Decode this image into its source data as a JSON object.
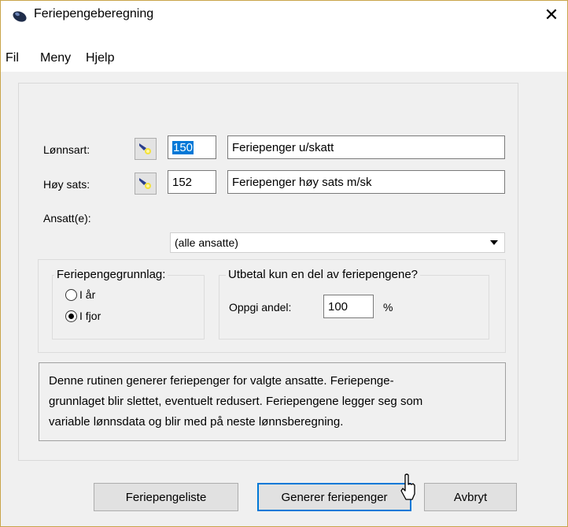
{
  "window": {
    "title": "Feriepengeberegning",
    "close_glyph": "✕"
  },
  "menu": [
    "Fil",
    "Meny",
    "Hjelp"
  ],
  "form": {
    "lonnsart": {
      "label": "Lønnsart:",
      "code": "150",
      "description": "Feriepenger u/skatt"
    },
    "hoy_sats": {
      "label": "Høy sats:",
      "code": "152",
      "description": "Feriepenger høy sats m/sk"
    },
    "ansatte": {
      "label": "Ansatt(e):",
      "value": "(alle ansatte)"
    }
  },
  "grunnlag": {
    "title": "Feriepengegrunnlag:",
    "options": [
      {
        "label": "I år",
        "checked": false
      },
      {
        "label": "I fjor",
        "checked": true
      }
    ]
  },
  "utbetal": {
    "title": "Utbetal kun en del av feriepengene?",
    "andel_label": "Oppgi andel:",
    "andel_value": "100",
    "unit": "%"
  },
  "description": [
    "Denne rutinen generer feriepenger for valgte ansatte. Feriepenge-",
    "grunnlaget blir slettet, eventuelt redusert. Feriepengene legger seg som",
    "variable lønnsdata og blir med på neste lønnsberegning."
  ],
  "buttons": {
    "feriepengeliste": "Feriepengeliste",
    "generer": "Generer feriepenger",
    "avbryt": "Avbryt"
  },
  "icons": {
    "app": "app-icon",
    "lookup": "lookup-icon",
    "close": "close-icon",
    "cursor": "mouse-cursor-icon"
  }
}
